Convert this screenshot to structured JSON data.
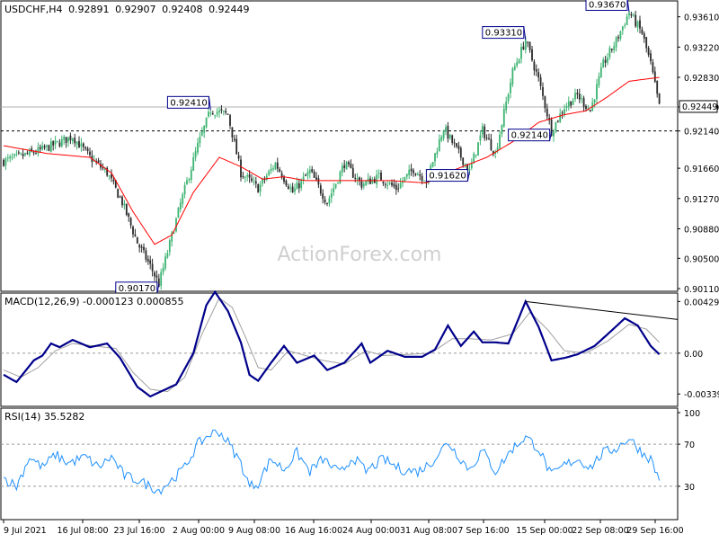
{
  "symbol_header": "USDCHF,H4",
  "ohlc": [
    "0.92891",
    "0.92907",
    "0.92408",
    "0.92449"
  ],
  "watermark": "ActionForex.com",
  "colors": {
    "bull": "#3cb371",
    "bear": "#2a2a2a",
    "ma": "#ff0000",
    "macd": "#00008b",
    "signal": "#a0a0a0",
    "rsi": "#1e90ff",
    "box_border": "#00008b"
  },
  "chart_data": [
    {
      "type": "candlestick",
      "panel": "main",
      "title": "USDCHF,H4",
      "ylim": [
        0.9011,
        0.9378
      ],
      "y_ticks": [
        "0.93610",
        "0.93220",
        "0.92830",
        "0.92449",
        "0.92140",
        "0.91660",
        "0.91270",
        "0.90880",
        "0.90500",
        "0.90110"
      ],
      "x_ticks": [
        "9 Jul 2021",
        "16 Jul 08:00",
        "23 Jul 16:00",
        "2 Aug 00:00",
        "9 Aug 08:00",
        "16 Aug 16:00",
        "24 Aug 00:00",
        "31 Aug 08:00",
        "7 Sep 16:00",
        "15 Sep 00:00",
        "22 Sep 08:00",
        "29 Sep 16:00"
      ],
      "current_price": "0.92449",
      "horizontal_level": "0.92140",
      "close_anchors": [
        [
          0,
          0.9175
        ],
        [
          10,
          0.9183
        ],
        [
          18,
          0.919
        ],
        [
          25,
          0.9198
        ],
        [
          32,
          0.9207
        ],
        [
          40,
          0.918
        ],
        [
          48,
          0.916
        ],
        [
          55,
          0.9122
        ],
        [
          62,
          0.907
        ],
        [
          68,
          0.904
        ],
        [
          72,
          0.9017
        ],
        [
          76,
          0.9058
        ],
        [
          82,
          0.912
        ],
        [
          90,
          0.9195
        ],
        [
          96,
          0.9241
        ],
        [
          104,
          0.9235
        ],
        [
          110,
          0.916
        ],
        [
          118,
          0.914
        ],
        [
          126,
          0.9172
        ],
        [
          134,
          0.9135
        ],
        [
          142,
          0.9162
        ],
        [
          150,
          0.9122
        ],
        [
          158,
          0.9172
        ],
        [
          166,
          0.9145
        ],
        [
          174,
          0.9155
        ],
        [
          182,
          0.914
        ],
        [
          190,
          0.9165
        ],
        [
          196,
          0.915
        ],
        [
          204,
          0.9218
        ],
        [
          210,
          0.919
        ],
        [
          216,
          0.9162
        ],
        [
          222,
          0.9215
        ],
        [
          228,
          0.9185
        ],
        [
          236,
          0.929
        ],
        [
          242,
          0.9331
        ],
        [
          248,
          0.928
        ],
        [
          254,
          0.9214
        ],
        [
          260,
          0.9245
        ],
        [
          266,
          0.926
        ],
        [
          272,
          0.924
        ],
        [
          278,
          0.93
        ],
        [
          284,
          0.933
        ],
        [
          290,
          0.9367
        ],
        [
          296,
          0.934
        ],
        [
          300,
          0.93
        ],
        [
          304,
          0.9245
        ]
      ],
      "ma_anchors": [
        [
          0,
          0.9195
        ],
        [
          20,
          0.9185
        ],
        [
          40,
          0.918
        ],
        [
          50,
          0.916
        ],
        [
          60,
          0.911
        ],
        [
          70,
          0.9068
        ],
        [
          78,
          0.908
        ],
        [
          88,
          0.9135
        ],
        [
          100,
          0.918
        ],
        [
          110,
          0.9168
        ],
        [
          120,
          0.9152
        ],
        [
          130,
          0.9155
        ],
        [
          140,
          0.915
        ],
        [
          160,
          0.915
        ],
        [
          180,
          0.915
        ],
        [
          196,
          0.9147
        ],
        [
          210,
          0.9165
        ],
        [
          224,
          0.918
        ],
        [
          236,
          0.92
        ],
        [
          248,
          0.9225
        ],
        [
          260,
          0.9235
        ],
        [
          270,
          0.924
        ],
        [
          280,
          0.9258
        ],
        [
          290,
          0.9278
        ],
        [
          304,
          0.9283
        ]
      ],
      "labels": [
        {
          "text": "0.93670",
          "value": 0.9367,
          "bar": 290
        },
        {
          "text": "0.93310",
          "value": 0.9331,
          "bar": 242
        },
        {
          "text": "0.92410",
          "value": 0.9241,
          "bar": 96
        },
        {
          "text": "0.92140",
          "value": 0.9214,
          "bar": 254
        },
        {
          "text": "0.91620",
          "value": 0.9162,
          "bar": 216
        },
        {
          "text": "0.90170",
          "value": 0.9017,
          "bar": 72
        }
      ]
    },
    {
      "type": "line",
      "panel": "macd",
      "title": "MACD(12,26,9) -0.000123 0.000855",
      "ylim": [
        -0.0042,
        0.0047
      ],
      "y_ticks": [
        "0.004299",
        "0.00",
        "-0.003396"
      ],
      "series": [
        {
          "role": "macd",
          "anchors": [
            [
              0,
              -0.0018
            ],
            [
              6,
              -0.0024
            ],
            [
              14,
              -0.0006
            ],
            [
              18,
              -0.0002
            ],
            [
              22,
              0.0008
            ],
            [
              26,
              0.0005
            ],
            [
              32,
              0.0011
            ],
            [
              40,
              0.0005
            ],
            [
              48,
              0.0008
            ],
            [
              54,
              -0.0004
            ],
            [
              62,
              -0.0028
            ],
            [
              68,
              -0.0036
            ],
            [
              74,
              -0.0031
            ],
            [
              80,
              -0.0026
            ],
            [
              88,
              0.0
            ],
            [
              94,
              0.004
            ],
            [
              98,
              0.0051
            ],
            [
              104,
              0.0035
            ],
            [
              110,
              0.0009
            ],
            [
              114,
              -0.0018
            ],
            [
              118,
              -0.0023
            ],
            [
              124,
              -0.0008
            ],
            [
              130,
              0.0006
            ],
            [
              136,
              -0.0008
            ],
            [
              144,
              -0.0002
            ],
            [
              150,
              -0.0014
            ],
            [
              158,
              -0.0008
            ],
            [
              166,
              0.0008
            ],
            [
              170,
              -0.0008
            ],
            [
              178,
              0.0002
            ],
            [
              186,
              -0.0003
            ],
            [
              194,
              -0.0003
            ],
            [
              200,
              0.0003
            ],
            [
              206,
              0.0023
            ],
            [
              212,
              0.0006
            ],
            [
              218,
              0.0018
            ],
            [
              222,
              0.0009
            ],
            [
              228,
              0.0009
            ],
            [
              234,
              0.0008
            ],
            [
              242,
              0.0043
            ],
            [
              248,
              0.0022
            ],
            [
              254,
              -0.0006
            ],
            [
              260,
              -0.0004
            ],
            [
              266,
              -0.0001
            ],
            [
              274,
              0.0006
            ],
            [
              282,
              0.0019
            ],
            [
              288,
              0.0029
            ],
            [
              294,
              0.0023
            ],
            [
              300,
              0.0006
            ],
            [
              304,
              -0.0001
            ]
          ]
        },
        {
          "role": "signal",
          "anchors": [
            [
              0,
              -0.0014
            ],
            [
              8,
              -0.002
            ],
            [
              16,
              -0.0012
            ],
            [
              24,
              0.0002
            ],
            [
              32,
              0.0008
            ],
            [
              42,
              0.0006
            ],
            [
              52,
              0.0004
            ],
            [
              60,
              -0.0016
            ],
            [
              68,
              -0.003
            ],
            [
              76,
              -0.0032
            ],
            [
              84,
              -0.002
            ],
            [
              92,
              0.0016
            ],
            [
              100,
              0.0046
            ],
            [
              106,
              0.0038
            ],
            [
              112,
              0.0014
            ],
            [
              118,
              -0.0012
            ],
            [
              124,
              -0.0014
            ],
            [
              132,
              0.0002
            ],
            [
              140,
              -0.0002
            ],
            [
              148,
              -0.0006
            ],
            [
              158,
              -0.0009
            ],
            [
              168,
              0.0002
            ],
            [
              176,
              -0.0002
            ],
            [
              188,
              -0.0001
            ],
            [
              198,
              0.0
            ],
            [
              208,
              0.0012
            ],
            [
              216,
              0.0012
            ],
            [
              226,
              0.0011
            ],
            [
              236,
              0.0016
            ],
            [
              244,
              0.0034
            ],
            [
              252,
              0.002
            ],
            [
              260,
              0.0002
            ],
            [
              270,
              0.0
            ],
            [
              280,
              0.001
            ],
            [
              290,
              0.0024
            ],
            [
              298,
              0.002
            ],
            [
              304,
              0.0009
            ]
          ]
        }
      ],
      "trendline": [
        [
          242,
          0.0043
        ],
        [
          304,
          0.0028
        ]
      ]
    },
    {
      "type": "line",
      "panel": "rsi",
      "title": "RSI(14) 35.5282",
      "ylim": [
        0,
        100
      ],
      "y_ticks": [
        "100",
        "70",
        "30"
      ],
      "levels": [
        70,
        30
      ],
      "anchors": [
        [
          0,
          38
        ],
        [
          6,
          30
        ],
        [
          12,
          58
        ],
        [
          18,
          48
        ],
        [
          24,
          60
        ],
        [
          30,
          52
        ],
        [
          38,
          58
        ],
        [
          44,
          48
        ],
        [
          50,
          58
        ],
        [
          56,
          40
        ],
        [
          62,
          36
        ],
        [
          68,
          30
        ],
        [
          72,
          26
        ],
        [
          78,
          36
        ],
        [
          84,
          48
        ],
        [
          90,
          70
        ],
        [
          96,
          80
        ],
        [
          100,
          82
        ],
        [
          104,
          72
        ],
        [
          110,
          52
        ],
        [
          114,
          30
        ],
        [
          118,
          33
        ],
        [
          124,
          56
        ],
        [
          130,
          46
        ],
        [
          136,
          62
        ],
        [
          142,
          44
        ],
        [
          148,
          56
        ],
        [
          156,
          42
        ],
        [
          162,
          58
        ],
        [
          168,
          44
        ],
        [
          176,
          56
        ],
        [
          184,
          46
        ],
        [
          192,
          44
        ],
        [
          198,
          52
        ],
        [
          206,
          72
        ],
        [
          212,
          56
        ],
        [
          216,
          46
        ],
        [
          222,
          64
        ],
        [
          228,
          44
        ],
        [
          236,
          66
        ],
        [
          242,
          77
        ],
        [
          248,
          66
        ],
        [
          254,
          40
        ],
        [
          260,
          50
        ],
        [
          266,
          56
        ],
        [
          272,
          48
        ],
        [
          278,
          62
        ],
        [
          284,
          66
        ],
        [
          290,
          76
        ],
        [
          296,
          62
        ],
        [
          300,
          56
        ],
        [
          304,
          36
        ]
      ]
    }
  ]
}
